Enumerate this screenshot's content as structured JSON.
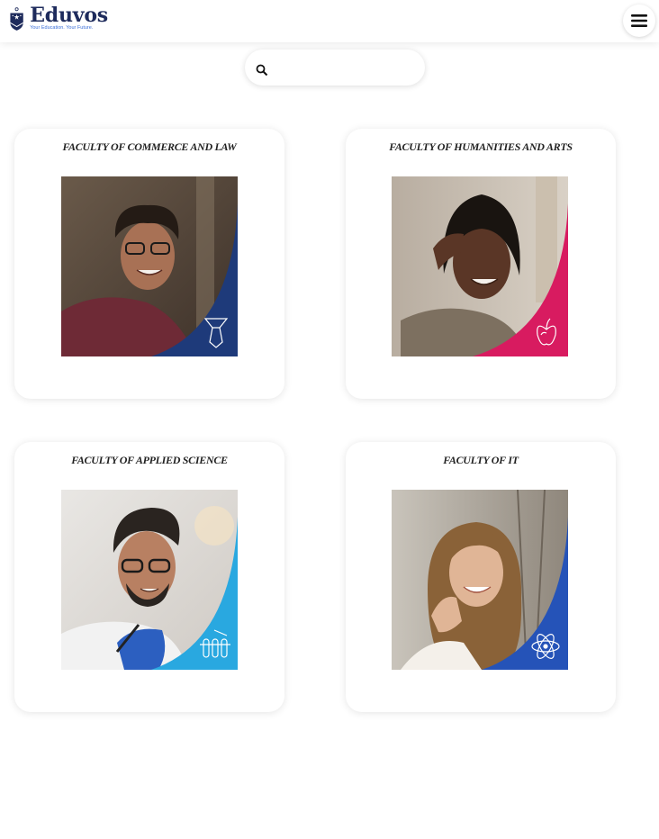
{
  "header": {
    "brand": "Eduvos",
    "tagline": "Your Education. Your Future.",
    "menu_icon": "hamburger-menu-icon"
  },
  "search": {
    "placeholder": "",
    "value": "",
    "icon": "search-icon"
  },
  "faculties": [
    {
      "title": "FACULTY OF COMMERCE AND LAW",
      "accent": "#1e3a7a",
      "icon": "tie-icon"
    },
    {
      "title": "FACULTY OF HUMANITIES AND ARTS",
      "accent": "#d81b60",
      "icon": "apple-icon"
    },
    {
      "title": "FACULTY OF APPLIED SCIENCE",
      "accent": "#29a8e0",
      "icon": "test-tubes-icon"
    },
    {
      "title": "FACULTY OF IT",
      "accent": "#2553b8",
      "icon": "atom-icon"
    }
  ]
}
